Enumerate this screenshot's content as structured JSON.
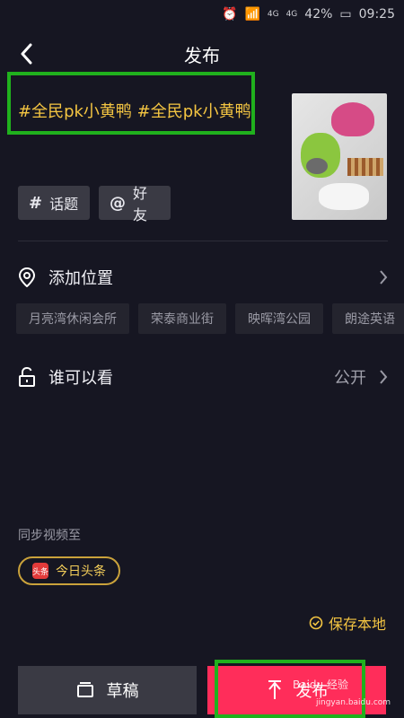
{
  "status": {
    "time": "09:25",
    "battery": "42%",
    "network_1": "4G",
    "network_2": "4G"
  },
  "header": {
    "title": "发布"
  },
  "hashtags": "#全民pk小黄鸭 #全民pk小黄鸭",
  "chips": {
    "topic": "话题",
    "topic_glyph": "#",
    "friends": "好友",
    "friends_glyph": "@"
  },
  "location": {
    "label": "添加位置",
    "suggestions": [
      "月亮湾休闲会所",
      "荣泰商业街",
      "映晖湾公园",
      "朗途英语"
    ]
  },
  "visibility": {
    "label": "谁可以看",
    "value": "公开"
  },
  "sync": {
    "label": "同步视频至",
    "target": "今日头条",
    "logo_text": "头条"
  },
  "save_local": "保存本地",
  "buttons": {
    "draft": "草稿",
    "publish": "发布"
  },
  "watermark": {
    "line1": "Baidu 经验",
    "line2": "jingyan.baidu.com"
  },
  "colors": {
    "accent": "#ff2d5a",
    "hashtag": "#f4c542",
    "highlight": "#20b11d",
    "background": "#161622"
  }
}
